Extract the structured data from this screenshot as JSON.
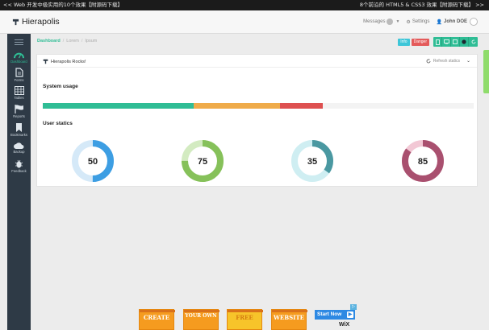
{
  "promo": {
    "left_text": "<< Web 开发中极实用的10个效果【附源码下载】",
    "right_text": "8个前沿的 HTML5 & CSS3 效果【附源码下载】 >>"
  },
  "header": {
    "brand": "Hierapolis",
    "messages_label": "Messages",
    "settings_label": "Settings",
    "user_label": "John DOE"
  },
  "sidebar": {
    "items": [
      {
        "label": "Dashboard",
        "icon": "dashboard-gauge-icon"
      },
      {
        "label": "Forms",
        "icon": "document-icon"
      },
      {
        "label": "Tables",
        "icon": "table-icon"
      },
      {
        "label": "Reports",
        "icon": "flag-icon"
      },
      {
        "label": "Bookmarks",
        "icon": "bookmark-icon"
      },
      {
        "label": "Backup",
        "icon": "cloud-icon"
      },
      {
        "label": "Feedback",
        "icon": "bug-icon"
      }
    ]
  },
  "breadcrumb": {
    "items": [
      "Dashboard",
      "Lorem",
      "Ipsum"
    ]
  },
  "toolbar": {
    "info_label": "Info",
    "danger_label": "Danger"
  },
  "card": {
    "title": "Hierapolis Rocks!",
    "refresh_label": "Refresh statics",
    "system_usage_title": "System usage",
    "user_statics_title": "User statics"
  },
  "usage_bar": [
    {
      "value": 35,
      "color": "#2fbd95"
    },
    {
      "value": 20,
      "color": "#efab4a"
    },
    {
      "value": 10,
      "color": "#de5050"
    }
  ],
  "donuts": [
    {
      "value": 50,
      "color": "#3d9ee3",
      "track": "#d5e9f8"
    },
    {
      "value": 75,
      "color": "#86c15a",
      "track": "#d3ebc1"
    },
    {
      "value": 35,
      "color": "#4a98a1",
      "track": "#cfeef2"
    },
    {
      "value": 85,
      "color": "#a9506f",
      "track": "#f2c8d5"
    }
  ],
  "ad": {
    "blocks": [
      "CREATE",
      "YOUR OWN",
      "FREE",
      "WEBSITE"
    ],
    "cta": "Start Now",
    "brand": "WiX"
  },
  "colors": {
    "accent": "#2fbd95",
    "sidebar_bg": "#2e3a46"
  }
}
